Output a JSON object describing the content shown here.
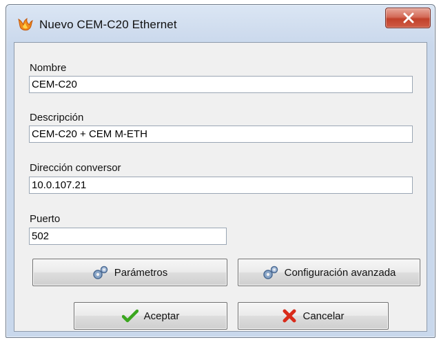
{
  "window": {
    "title": "Nuevo CEM-C20 Ethernet",
    "app_icon": "flame-icon",
    "close_icon": "close-icon"
  },
  "form": {
    "nombre": {
      "label": "Nombre",
      "value": "CEM-C20"
    },
    "descripcion": {
      "label": "Descripción",
      "value": "CEM-C20 + CEM M-ETH"
    },
    "direccion": {
      "label": "Dirección conversor",
      "value": "10.0.107.21"
    },
    "puerto": {
      "label": "Puerto",
      "value": "502"
    }
  },
  "buttons": {
    "parametros": {
      "label": "Parámetros",
      "icon": "gears-icon"
    },
    "configuracion": {
      "label": "Configuración avanzada",
      "icon": "gears-icon"
    },
    "aceptar": {
      "label": "Aceptar",
      "icon": "checkmark-icon"
    },
    "cancelar": {
      "label": "Cancelar",
      "icon": "cross-icon"
    }
  },
  "colors": {
    "check_green": "#3aa61e",
    "cross_red": "#d92b1a",
    "close_button": "#c7472f"
  }
}
